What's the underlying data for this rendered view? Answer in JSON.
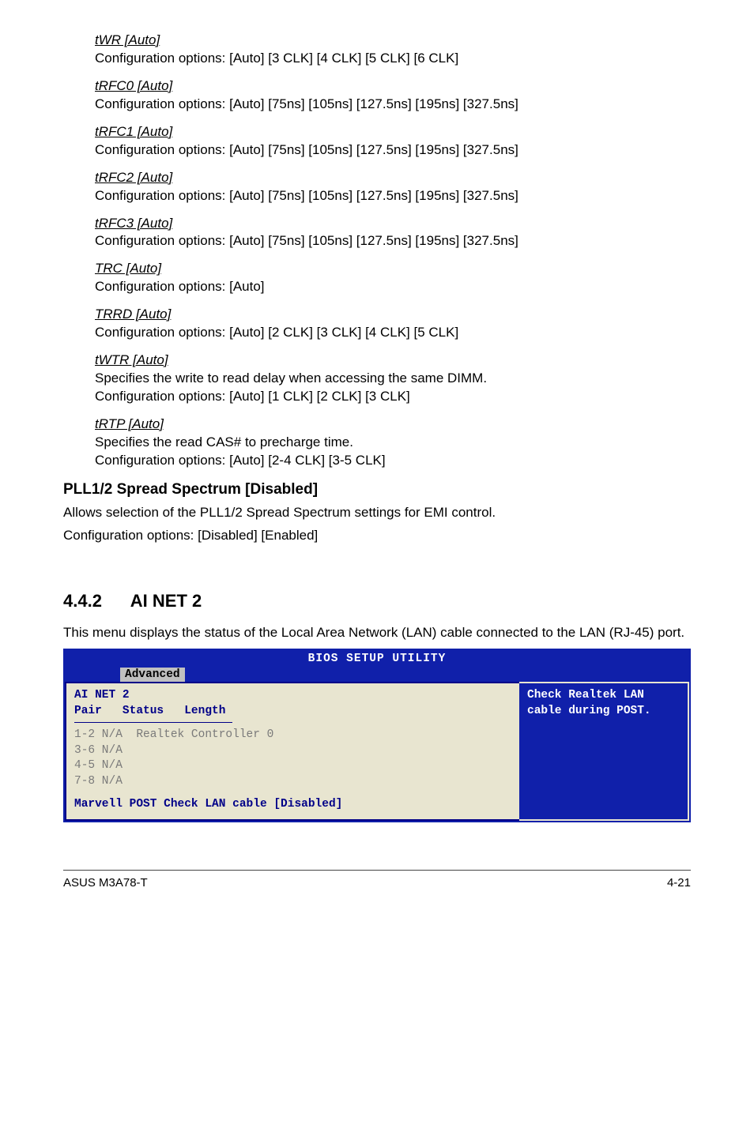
{
  "options": {
    "tWR": {
      "title": "tWR [Auto]",
      "text": "Configuration options: [Auto] [3 CLK] [4 CLK] [5 CLK] [6 CLK]"
    },
    "tRFC0": {
      "title": "tRFC0 [Auto]",
      "text": "Configuration options: [Auto] [75ns] [105ns] [127.5ns] [195ns] [327.5ns]"
    },
    "tRFC1": {
      "title": "tRFC1 [Auto]",
      "text": "Configuration options: [Auto] [75ns] [105ns] [127.5ns] [195ns] [327.5ns]"
    },
    "tRFC2": {
      "title": "tRFC2 [Auto]",
      "text": "Configuration options: [Auto] [75ns] [105ns] [127.5ns] [195ns] [327.5ns]"
    },
    "tRFC3": {
      "title": "tRFC3 [Auto]",
      "text": "Configuration options: [Auto] [75ns] [105ns] [127.5ns] [195ns] [327.5ns]"
    },
    "TRC": {
      "title": "TRC [Auto]",
      "text": "Configuration options: [Auto]"
    },
    "TRRD": {
      "title": "TRRD [Auto]",
      "text": "Configuration options: [Auto] [2 CLK] [3 CLK] [4 CLK] [5 CLK]"
    },
    "tWTR": {
      "title": "tWTR [Auto]",
      "desc": "Specifies the write to read delay when accessing the same DIMM.",
      "text": "Configuration options: [Auto] [1 CLK] [2 CLK] [3 CLK]"
    },
    "tRTP": {
      "title": "tRTP [Auto]",
      "desc": "Specifies the read CAS# to precharge time.",
      "text": "Configuration options: [Auto] [2-4 CLK] [3-5 CLK]"
    }
  },
  "pll": {
    "heading": "PLL1/2 Spread Spectrum [Disabled]",
    "desc": "Allows selection of the PLL1/2 Spread Spectrum settings for EMI control.",
    "opts": "Configuration options: [Disabled] [Enabled]"
  },
  "section": {
    "num_title": "4.4.2      AI NET 2",
    "intro": "This menu displays the status of the Local Area Network (LAN) cable connected to the LAN (RJ-45) port."
  },
  "bios": {
    "title": "BIOS SETUP UTILITY",
    "tab": "Advanced",
    "head1": "AI NET 2",
    "head2": "Pair   Status   Length",
    "row1": "1-2 N/A  Realtek Controller 0",
    "row2": "3-6 N/A",
    "row3": "4-5 N/A",
    "row4": "7-8 N/A",
    "marvell": "Marvell POST Check LAN cable [Disabled]",
    "help": "Check Realtek LAN cable during POST."
  },
  "footer": {
    "left": "ASUS M3A78-T",
    "right": "4-21"
  }
}
